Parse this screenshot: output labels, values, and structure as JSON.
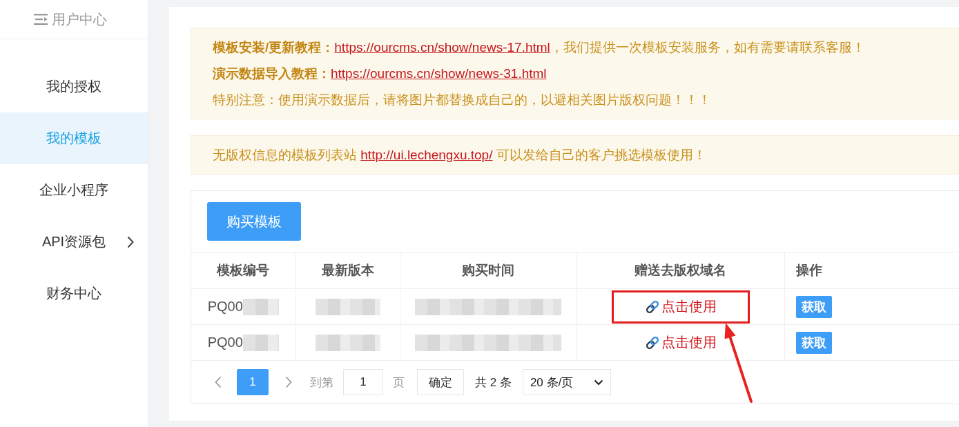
{
  "sidebar": {
    "title": "用户中心",
    "items": [
      {
        "label": "我的授权",
        "selected": false,
        "has_submenu": false
      },
      {
        "label": "我的模板",
        "selected": true,
        "has_submenu": false
      },
      {
        "label": "企业小程序",
        "selected": false,
        "has_submenu": false
      },
      {
        "label": "API资源包",
        "selected": false,
        "has_submenu": true
      },
      {
        "label": "财务中心",
        "selected": false,
        "has_submenu": false
      }
    ]
  },
  "notices": [
    {
      "lines": [
        {
          "segments": [
            {
              "kind": "bold",
              "text": "模板安装/更新教程："
            },
            {
              "kind": "link",
              "text": "https://ourcms.cn/show/news-17.html"
            },
            {
              "kind": "plain",
              "text": "，我们提供一次模板安装服务，如有需要请联系客服！"
            }
          ]
        },
        {
          "segments": [
            {
              "kind": "bold",
              "text": "演示数据导入教程："
            },
            {
              "kind": "link",
              "text": "https://ourcms.cn/show/news-31.html"
            }
          ]
        },
        {
          "segments": [
            {
              "kind": "plain",
              "text": "特别注意：使用演示数据后，请将图片都替换成自己的，以避相关图片版权问题！！！"
            }
          ]
        }
      ]
    },
    {
      "lines": [
        {
          "segments": [
            {
              "kind": "plain",
              "text": "无版权信息的模板列表站 "
            },
            {
              "kind": "link",
              "text": "http://ui.lechengxu.top/"
            },
            {
              "kind": "plain",
              "text": " 可以发给自己的客户挑选模板使用！"
            }
          ]
        }
      ]
    }
  ],
  "table": {
    "toolbar_button": "购买模板",
    "columns": [
      "模板编号",
      "最新版本",
      "购买时间",
      "赠送去版权域名",
      "操作"
    ],
    "rows": [
      {
        "template_no": {
          "text": "PQ00",
          "redacted": true
        },
        "latest_version": {
          "redacted": true
        },
        "purchase_time": {
          "redacted": true
        },
        "domain_link": "点击使用",
        "action": "获取",
        "highlighted": true
      },
      {
        "template_no": {
          "text": "PQ00",
          "redacted": true
        },
        "latest_version": {
          "redacted": true
        },
        "purchase_time": {
          "redacted": true
        },
        "domain_link": "点击使用",
        "action": "获取",
        "highlighted": false
      }
    ]
  },
  "pagination": {
    "pages": [
      {
        "label": "1",
        "selected": true
      }
    ],
    "goto_label": "到第",
    "goto_value": "1",
    "page_unit": "页",
    "confirm": "确定",
    "total": "共 2 条",
    "page_size": "20 条/页"
  },
  "annotation_arrow": true
}
